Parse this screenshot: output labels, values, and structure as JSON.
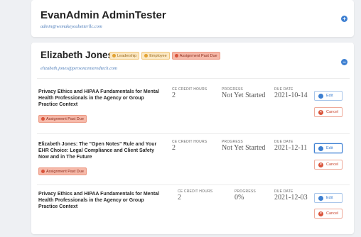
{
  "users": [
    {
      "name": "EvanAdmin AdminTester",
      "email": "admin@wemakeyoubetterllc.com"
    },
    {
      "name": "Elizabeth Jones",
      "email": "elizabeth.jones@personcenteredtech.com",
      "badges": [
        "Leadership",
        "Employee",
        "Assignment Past Due"
      ]
    }
  ],
  "columns": {
    "credit_hours": "CE CREDIT HOURS",
    "progress": "PROGRESS",
    "due_date": "DUE DATE"
  },
  "assignments": [
    {
      "title": "Privacy Ethics and HIPAA Fundamentals for Mental Health Professionals in the Agency or Group Practice Context",
      "credit_hours": "2",
      "progress": "Not Yet Started",
      "due_date": "2021-10-14",
      "status_badge": "Assignment Past Due"
    },
    {
      "title": "Elizabeth Jones: The \"Open Notes\" Rule and Your EHR Choice: Legal Compliance and Client Safety Now and in The Future",
      "credit_hours": "2",
      "progress": "Not Yet Started",
      "due_date": "2021-12-11",
      "status_badge": "Assignment Past Due"
    },
    {
      "title": "Privacy Ethics and HIPAA Fundamentals for Mental Health Professionals in the Agency or Group Practice Context",
      "credit_hours": "2",
      "progress": "0%",
      "due_date": "2021-12-03",
      "status_badge": ""
    }
  ],
  "buttons": {
    "edit": "Edit",
    "cancel": "Cancel",
    "expand_symbol": "+",
    "collapse_symbol": "−"
  },
  "colors": {
    "accent": "#3d7fd1",
    "danger": "#d9533a",
    "warning": "#e2a231"
  }
}
